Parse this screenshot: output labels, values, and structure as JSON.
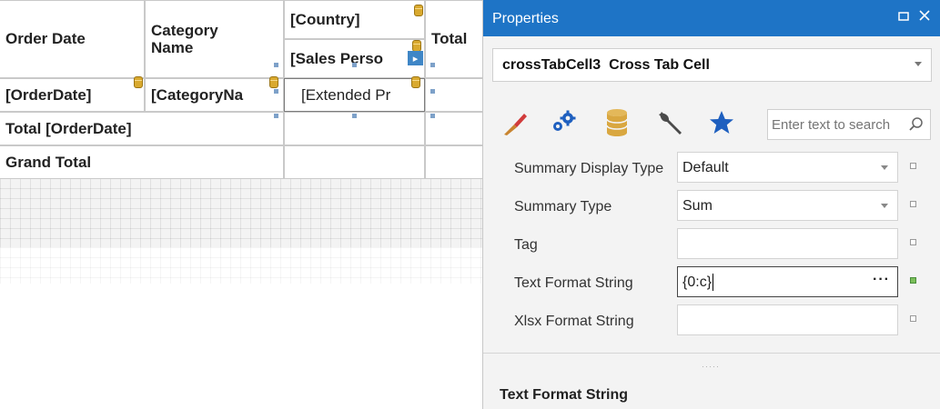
{
  "crosstab": {
    "header_order_date": "Order Date",
    "header_category_name": "Category Name",
    "country": "[Country]",
    "sales_person": "[Sales Perso",
    "total_header": "Total",
    "row_order_date": "[OrderDate]",
    "row_category": "[CategoryNa",
    "cell_extended": "[Extended Pr",
    "total_order_date": "Total [OrderDate]",
    "grand_total": "Grand Total"
  },
  "properties_panel": {
    "title": "Properties",
    "selected_object": "crossTabCell3  Cross Tab Cell",
    "search_placeholder": "Enter text to search",
    "tabs": [
      "appearance",
      "behavior",
      "data",
      "design",
      "favorites"
    ],
    "rows": [
      {
        "label": "Summary Display Type",
        "value": "Default"
      },
      {
        "label": "Summary Type",
        "value": "Sum"
      },
      {
        "label": "Tag",
        "value": ""
      },
      {
        "label": "Text Format String",
        "value": "{0:c}"
      },
      {
        "label": "Xlsx Format String",
        "value": ""
      }
    ],
    "description_title": "Text Format String",
    "colors": {
      "titlebar": "#1e74c6",
      "accent_icon": "#1e5fbf",
      "modified_marker": "#7bbf5a"
    }
  }
}
